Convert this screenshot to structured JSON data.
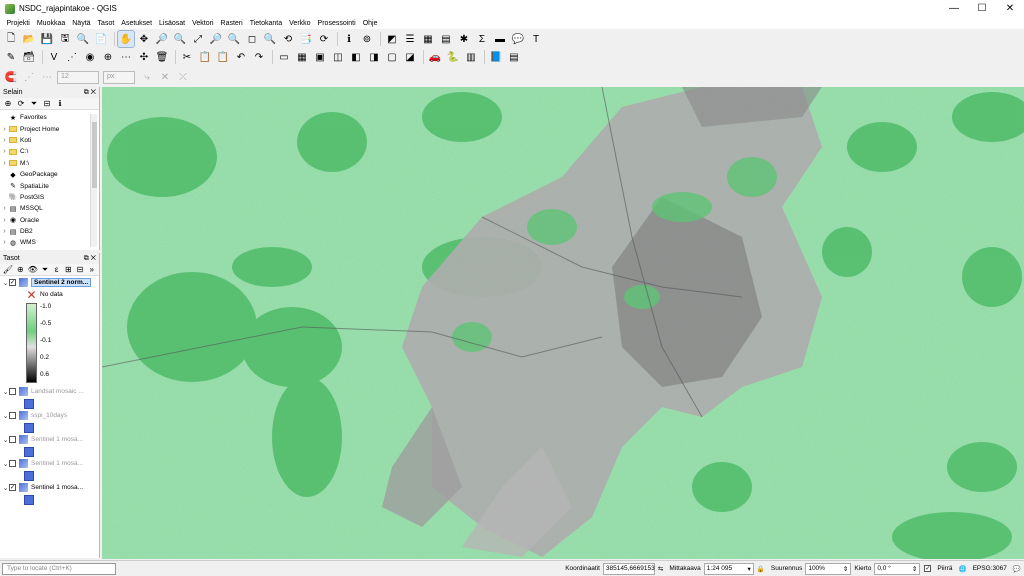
{
  "window": {
    "title": "NSDC_rajapintakoe - QGIS",
    "minimize": "—",
    "maximize": "☐",
    "close": "✕"
  },
  "menu": [
    "Projekti",
    "Muokkaa",
    "Näytä",
    "Tasot",
    "Asetukset",
    "Lisäosat",
    "Vektori",
    "Rasteri",
    "Tietokanta",
    "Verkko",
    "Prosessointi",
    "Ohje"
  ],
  "toolbar": {
    "row1": [
      "🗋",
      "📂",
      "💾",
      "🖫",
      "🔍",
      "📄",
      "✋",
      "✥",
      "🔎",
      "🔍",
      "⤢",
      "🔎",
      "🔍",
      "◻",
      "🔍",
      "⟲",
      "📑",
      "⟳",
      "ℹ",
      "⊚",
      "◩",
      "☰",
      "▦",
      "▤",
      "✱",
      "Σ",
      "▬",
      "💬",
      "T"
    ],
    "row2": [
      "✎",
      "🗃",
      "V",
      "⋰",
      "◉",
      "⊕",
      "⋯",
      "✣",
      "🗑",
      "✂",
      "📋",
      "📋",
      "↶",
      "↷",
      "▭",
      "▦",
      "▣",
      "◫",
      "◧",
      "◨",
      "▢",
      "◪",
      "🚗",
      "🐍",
      "▥",
      "📘",
      "▤"
    ],
    "row3": [
      "🧲",
      "⋰",
      "⋯"
    ],
    "snap_tolerance": "12",
    "snap_unit": "px"
  },
  "browser": {
    "title": "Selain",
    "items": [
      {
        "label": "Favorites",
        "icon": "★",
        "arrow": ""
      },
      {
        "label": "Project Home",
        "icon": "folder",
        "arrow": "›"
      },
      {
        "label": "Koti",
        "icon": "folder",
        "arrow": "›"
      },
      {
        "label": "C:\\",
        "icon": "folder",
        "arrow": "›"
      },
      {
        "label": "M:\\",
        "icon": "folder",
        "arrow": "›"
      },
      {
        "label": "GeoPackage",
        "icon": "◆",
        "arrow": ""
      },
      {
        "label": "SpatiaLite",
        "icon": "✎",
        "arrow": ""
      },
      {
        "label": "PostGIS",
        "icon": "🐘",
        "arrow": ""
      },
      {
        "label": "MSSQL",
        "icon": "▤",
        "arrow": "›"
      },
      {
        "label": "Oracle",
        "icon": "◉",
        "arrow": "›"
      },
      {
        "label": "DB2",
        "icon": "▤",
        "arrow": "›"
      },
      {
        "label": "WMS",
        "icon": "◍",
        "arrow": "›"
      }
    ]
  },
  "layers": {
    "title": "Tasot",
    "legend": {
      "nodata": "No data",
      "values": [
        "-1.0",
        "-0.5",
        "-0.1",
        "0.2",
        "0.6"
      ]
    },
    "items": [
      {
        "name": "Sentinel 2 norm...",
        "checked": true,
        "selected": true,
        "active": true
      },
      {
        "name": "Landsat mosaic ...",
        "checked": false,
        "selected": false,
        "active": false
      },
      {
        "name": "sspi_10days",
        "checked": false,
        "selected": false,
        "active": false
      },
      {
        "name": "Sentinel 1 mosa...",
        "checked": false,
        "selected": false,
        "active": false
      },
      {
        "name": "Sentinel 1 mosa...",
        "checked": false,
        "selected": false,
        "active": false
      },
      {
        "name": "Sentinel 1 mosa...",
        "checked": true,
        "selected": false,
        "active": true
      }
    ]
  },
  "status": {
    "locator_placeholder": "Type to locate (Ctrl+K)",
    "coord_label": "Koordinaatit",
    "coord_value": "385145,6669153",
    "scale_label": "Mittakaava",
    "scale_value": "1:24 095",
    "magnifier_label": "Suurennus",
    "magnifier_value": "100%",
    "rotation_label": "Kierto",
    "rotation_value": "0,0 °",
    "render_label": "Piirrä",
    "crs": "EPSG:3067"
  },
  "colors": {
    "accent": "#3c78d8",
    "map_green": "#8fd9a3",
    "urban_gray": "#9a9a9a"
  }
}
